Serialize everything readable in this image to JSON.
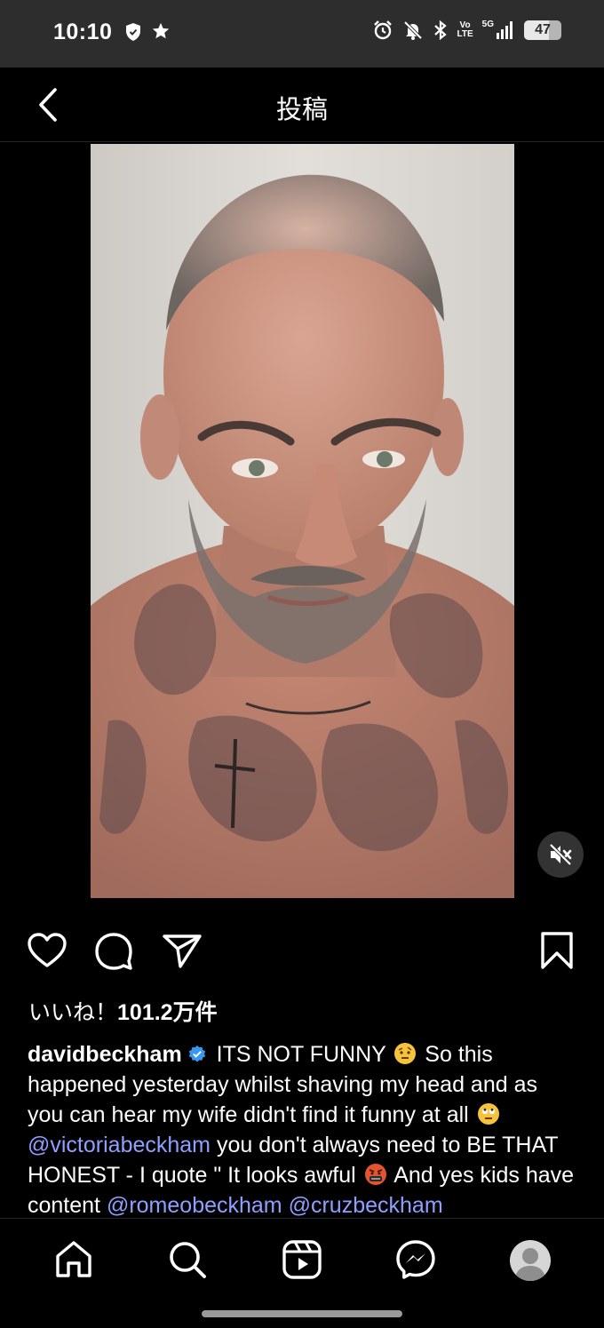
{
  "status_bar": {
    "time": "10:10",
    "network_label_top": "Vo",
    "network_label_bottom": "LTE",
    "signal_label": "5G",
    "battery": "47"
  },
  "header": {
    "title": "投稿"
  },
  "post": {
    "likes_prefix": "いいね！",
    "likes_count": "101.2万件",
    "username": "davidbeckham",
    "caption_part1": " ITS NOT FUNNY ",
    "caption_part2": " So this happened yesterday whilst shaving my head and as you can hear my wife didn't find it funny at all ",
    "mention_1": "@victoriabeckham",
    "caption_part3": " you don't always need to BE THAT HONEST - I quote \" It looks awful ",
    "caption_part4": " And yes kids have content ",
    "mention_2": "@romeobeckham",
    "mention_3": "@cruzbeckham"
  },
  "icons": {
    "back": "chevron-left-icon",
    "mute": "speaker-muted-icon",
    "like": "heart-icon",
    "comment": "comment-icon",
    "share": "send-icon",
    "save": "bookmark-icon",
    "home": "home-icon",
    "search": "search-icon",
    "reels": "reels-icon",
    "messages": "messenger-icon",
    "profile": "profile-avatar"
  },
  "colors": {
    "background": "#000000",
    "status_bar": "#2d2d2d",
    "mention": "#8ea0ff",
    "verified": "#3897f0"
  }
}
